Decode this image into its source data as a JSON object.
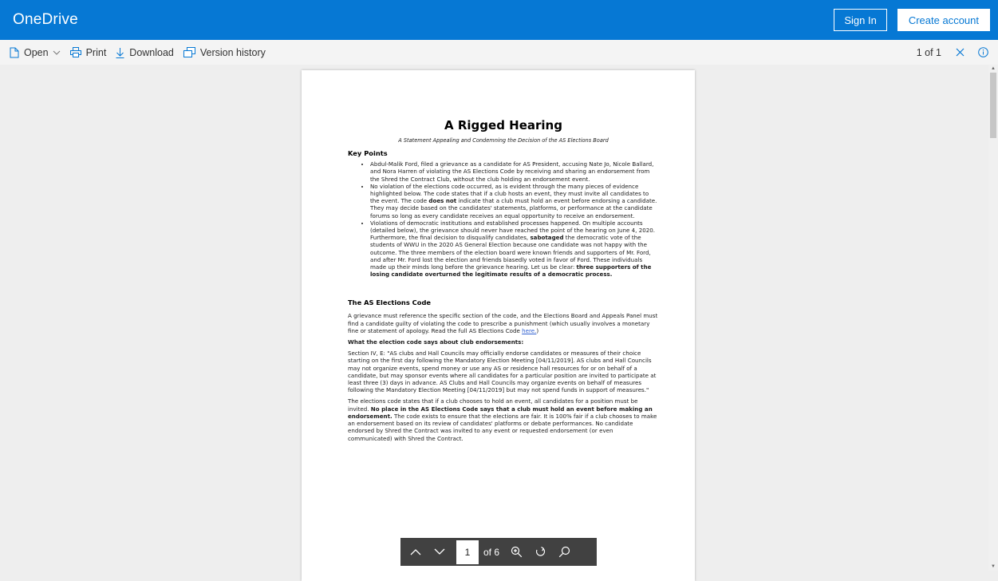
{
  "app": {
    "brand": "OneDrive",
    "sign_in": "Sign In",
    "create_account": "Create account"
  },
  "toolbar": {
    "open": "Open",
    "print": "Print",
    "download": "Download",
    "version_history": "Version history",
    "page_count": "1 of 1"
  },
  "document": {
    "title": "A Rigged Hearing",
    "subtitle": "A Statement Appealing and Condemning the Decision of the AS Elections Board",
    "key_points_heading": "Key Points",
    "bullet1": "Abdul-Malik Ford, filed a grievance as a candidate for AS President, accusing Nate Jo, Nicole Ballard, and Nora Harren of violating the AS Elections Code by receiving and sharing an endorsement from the Shred the Contract Club, without the club holding an endorsement event.",
    "bullet2": {
      "a": "No violation of the elections code occurred, as is evident through the many pieces of evidence highlighted below. The code states that if a club hosts an event, they must invite all candidates to the event. The code ",
      "b": "does not",
      "c": " indicate that a club must hold an event before endorsing a candidate. They may decide based on the candidates' statements, platforms, or performance at the candidate forums so long as every candidate receives an equal opportunity to receive an endorsement."
    },
    "bullet3": {
      "a": "Violations of democratic institutions and established processes happened. On multiple accounts (detailed below), the grievance should never have reached the point of the hearing on June 4, 2020. Furthermore, the final decision to disqualify candidates, ",
      "b": "sabotaged",
      "c": " the democratic vote of the students of WWU in the 2020 AS General Election because one candidate was not happy with the outcome. The three members of the election board were known friends and supporters of Mr. Ford, and after Mr. Ford lost the election and friends biasedly voted in favor of Ford. These individuals made up their minds long before the grievance hearing. Let us be clear: ",
      "d": "three supporters of the losing candidate overturned the legitimate results of a democratic process."
    },
    "code_heading": "The AS Elections Code",
    "code_para": {
      "a": "A grievance must reference the specific section of the code, and the Elections Board and Appeals Panel must find a candidate guilty of violating the code to prescribe a punishment (which usually involves a monetary fine or statement of apology. Read the full AS Elections Code ",
      "link": "here.",
      "b": ")"
    },
    "club_heading": "What the election code says about club endorsements:",
    "section_quote": "Section IV, E: \"AS clubs and Hall Councils may officially endorse candidates or measures of their choice starting on the first day following the Mandatory Election Meeting [04/11/2019]. AS clubs and Hall Councils may not organize events, spend money or use any AS or residence hall resources for or on behalf of a candidate, but may sponsor events where all candidates for a particular position are invited to participate at least three (3) days in advance. AS Clubs and Hall Councils may organize events on behalf of measures following the Mandatory Election Meeting [04/11/2019] but may not spend funds in support of measures.\"",
    "last_para": {
      "a": "The elections code states that if a club chooses to hold an event, all candidates for a position must be invited. ",
      "b": "No place in the AS Elections Code says that a club must hold an event before making an endorsement.",
      "c": " The code exists to ensure that the elections are fair. It is 100% fair if a club chooses to make an endorsement based on its review of candidates' platforms or debate performances. No candidate endorsed by Shred the Contract was invited to any event or requested endorsement (or even communicated) with Shred the Contract."
    }
  },
  "pager": {
    "current": "1",
    "of": "of 6"
  }
}
